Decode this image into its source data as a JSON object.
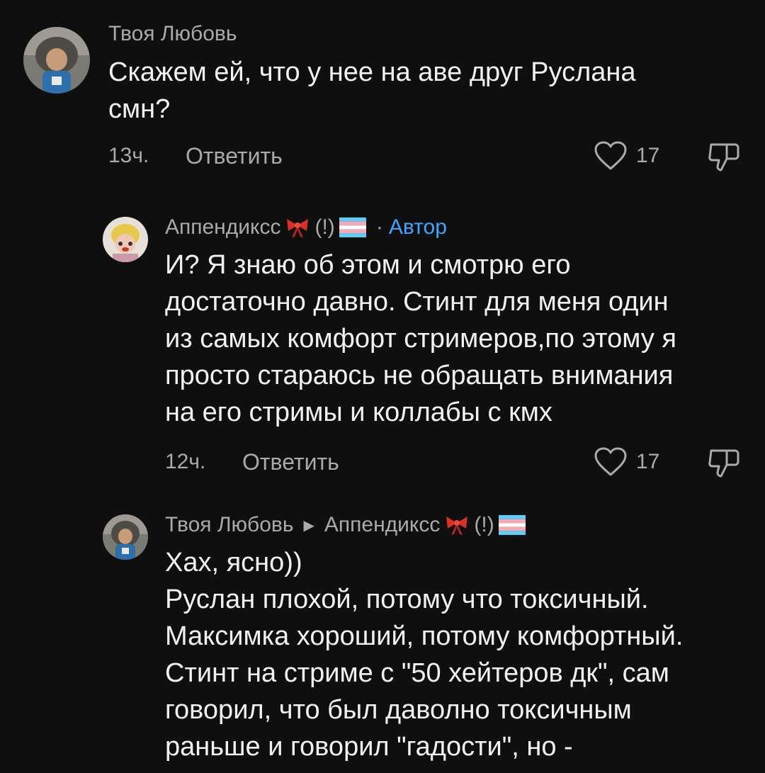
{
  "comments": [
    {
      "author": "Твоя Любовь",
      "lines": [
        "Скажем ей, что у нее на аве друг Руслана",
        "смн?"
      ],
      "time": "13ч.",
      "reply_label": "Ответить",
      "likes": "17"
    },
    {
      "author": "Аппендиксс",
      "author_suffix": "(!)",
      "author_tag": "Автор",
      "dot_sep": "·",
      "lines": [
        "И? Я знаю об этом и смотрю его",
        "достаточно давно. Стинт для меня один",
        "из самых комфорт стримеров,по этому я",
        "просто стараюсь не обращать внимания",
        "на его стримы и коллабы с кмх"
      ],
      "time": "12ч.",
      "reply_label": "Ответить",
      "likes": "17"
    },
    {
      "author": "Твоя Любовь",
      "reply_to": "Аппендиксс",
      "reply_to_suffix": "(!)",
      "lines": [
        "Хах, ясно))",
        "Руслан плохой, потому что токсичный.",
        "Максимка хороший, потому комфортный.",
        "Стинт на стриме с \"50 хейтеров дк\", сам",
        "говорил, что был даволно токсичным",
        "раньше и говорил \"гадости\", но -"
      ]
    }
  ],
  "icons": {
    "like": "heart-outline-icon",
    "dislike": "thumbs-down-outline-icon",
    "bow": "red-bow-emoji",
    "flag": "transgender-flag-emoji",
    "reply_arrow": "triangle-right-icon"
  },
  "colors": {
    "background": "#0f0f0f",
    "text": "#f1f1f1",
    "secondary": "#aaaaaa",
    "author_tag": "#3ea6ff"
  }
}
